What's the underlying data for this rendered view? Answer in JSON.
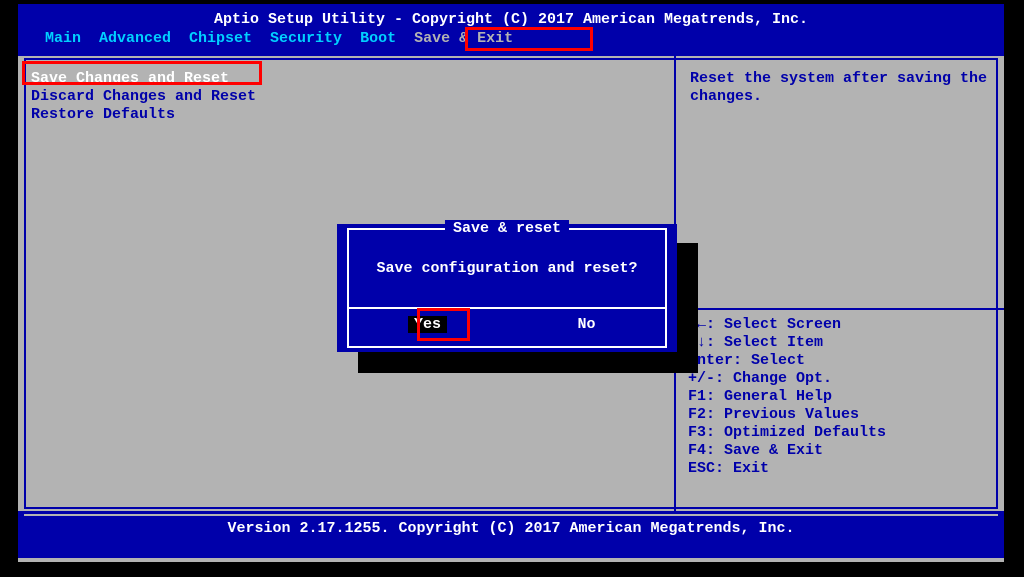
{
  "header": {
    "title": "Aptio Setup Utility - Copyright (C) 2017 American Megatrends, Inc.",
    "menu": [
      "Main",
      "Advanced",
      "Chipset",
      "Security",
      "Boot",
      "Save & Exit"
    ]
  },
  "left_pane": {
    "options": [
      "Save Changes and Reset",
      "Discard Changes and Reset",
      "Restore Defaults"
    ]
  },
  "right_pane": {
    "help": "Reset the system after saving the changes.",
    "keys": [
      "→←: Select Screen",
      "↑↓: Select Item",
      "Enter: Select",
      "+/-: Change Opt.",
      "F1: General Help",
      "F2: Previous Values",
      "F3: Optimized Defaults",
      "F4: Save & Exit",
      "ESC: Exit"
    ]
  },
  "dialog": {
    "title": "Save & reset",
    "message": "Save configuration and reset?",
    "yes": "Yes",
    "no": "No"
  },
  "footer": {
    "version": "Version 2.17.1255. Copyright (C) 2017 American Megatrends, Inc."
  }
}
